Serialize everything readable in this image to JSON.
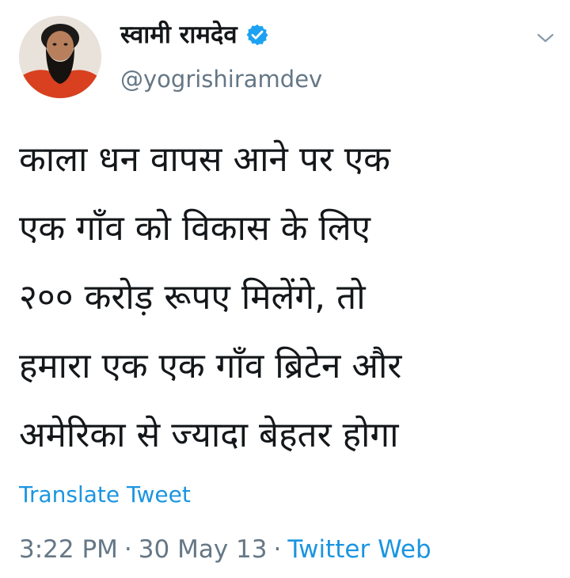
{
  "tweet": {
    "author": {
      "display_name": "स्वामी रामदेव",
      "handle": "@yogrishiramdev",
      "verified": true
    },
    "text_lines": [
      "काला धन वापस आने पर एक",
      "एक गाँव को विकास के लिए",
      "२०० करोड़ रूपए मिलेंगे, तो",
      "हमारा एक एक गाँव ब्रिटेन और",
      "अमेरिका से ज्यादा बेहतर होगा"
    ],
    "translate_label": "Translate Tweet",
    "time": "3:22 PM",
    "date": "30 May 13",
    "separator": "·",
    "source": "Twitter Web"
  },
  "icons": {
    "verified": "verified-badge-icon",
    "menu": "chevron-down-icon"
  },
  "colors": {
    "link": "#1b95e0",
    "secondary_text": "#657786",
    "primary_text": "#14171a",
    "verified": "#1da1f2"
  }
}
